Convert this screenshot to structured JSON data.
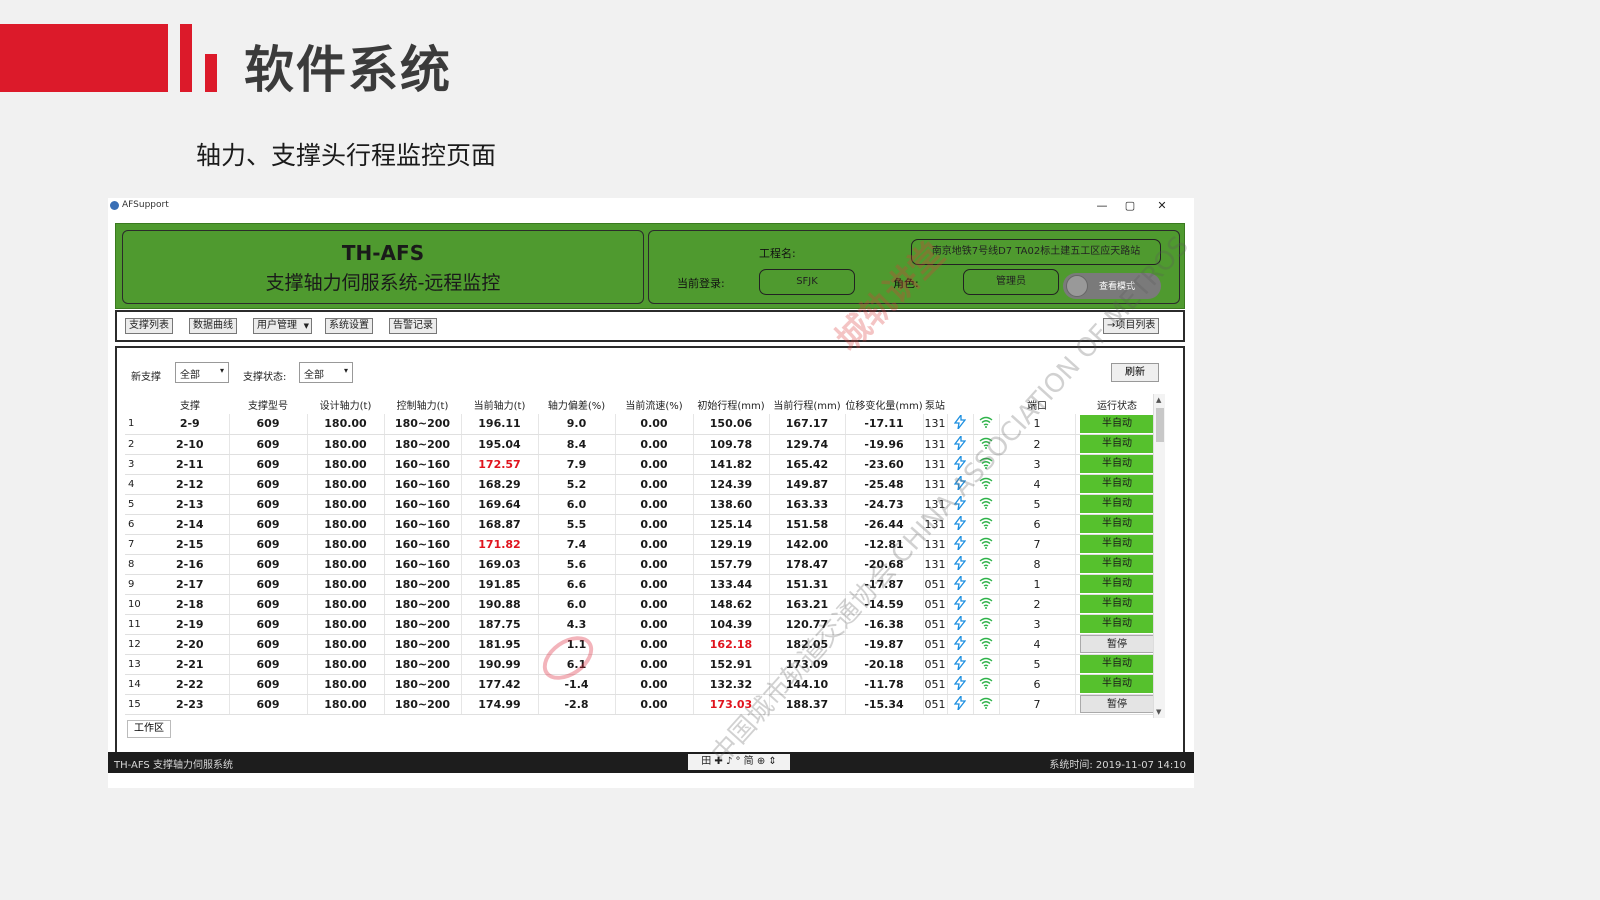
{
  "slide": {
    "title": "软件系统",
    "subtitle": "轴力、支撑头行程监控页面"
  },
  "window": {
    "app_name": "AFSupport",
    "min": "—",
    "max": "▢",
    "close": "✕"
  },
  "header": {
    "product": "TH-AFS",
    "system_name": "支撑轴力伺服系统-远程监控",
    "site_label": "工程名:",
    "site_value": "南京地铁7号线D7 TA02标土建五工区应天路站",
    "user_label": "当前登录:",
    "user_value": "SFJK",
    "role_label": "角色:",
    "role_value": "管理员",
    "toggle_label": "查看模式"
  },
  "toolbar": {
    "buttons": [
      "支撑列表",
      "数据曲线",
      "用户管理",
      "系统设置",
      "告警记录"
    ],
    "project_list": "→项目列表"
  },
  "filters": {
    "group_label": "新支撑",
    "group_value": "全部",
    "status_label": "支撑状态:",
    "status_value": "全部",
    "refresh": "刷新"
  },
  "table": {
    "headers": [
      "",
      "支撑",
      "支撑型号",
      "设计轴力(t)",
      "控制轴力(t)",
      "当前轴力(t)",
      "轴力偏差(%)",
      "当前流速(%)",
      "初始行程(mm)",
      "当前行程(mm)",
      "位移变化量(mm)",
      "泵站",
      "",
      "",
      "端口",
      "运行状态"
    ],
    "rows": [
      [
        "1",
        "2-9",
        "609",
        "180.00",
        "180~200",
        "196.11",
        "9.0",
        "0.00",
        "150.06",
        "167.17",
        "-17.11",
        "131",
        "1",
        "半自动"
      ],
      [
        "2",
        "2-10",
        "609",
        "180.00",
        "180~200",
        "195.04",
        "8.4",
        "0.00",
        "109.78",
        "129.74",
        "-19.96",
        "131",
        "2",
        "半自动"
      ],
      [
        "3",
        "2-11",
        "609",
        "180.00",
        "160~160",
        "172.57",
        "7.9",
        "0.00",
        "141.82",
        "165.42",
        "-23.60",
        "131",
        "3",
        "半自动"
      ],
      [
        "4",
        "2-12",
        "609",
        "180.00",
        "160~160",
        "168.29",
        "5.2",
        "0.00",
        "124.39",
        "149.87",
        "-25.48",
        "131",
        "4",
        "半自动"
      ],
      [
        "5",
        "2-13",
        "609",
        "180.00",
        "160~160",
        "169.64",
        "6.0",
        "0.00",
        "138.60",
        "163.33",
        "-24.73",
        "131",
        "5",
        "半自动"
      ],
      [
        "6",
        "2-14",
        "609",
        "180.00",
        "160~160",
        "168.87",
        "5.5",
        "0.00",
        "125.14",
        "151.58",
        "-26.44",
        "131",
        "6",
        "半自动"
      ],
      [
        "7",
        "2-15",
        "609",
        "180.00",
        "160~160",
        "171.82",
        "7.4",
        "0.00",
        "129.19",
        "142.00",
        "-12.81",
        "131",
        "7",
        "半自动"
      ],
      [
        "8",
        "2-16",
        "609",
        "180.00",
        "160~160",
        "169.03",
        "5.6",
        "0.00",
        "157.79",
        "178.47",
        "-20.68",
        "131",
        "8",
        "半自动"
      ],
      [
        "9",
        "2-17",
        "609",
        "180.00",
        "180~200",
        "191.85",
        "6.6",
        "0.00",
        "133.44",
        "151.31",
        "-17.87",
        "051",
        "1",
        "半自动"
      ],
      [
        "10",
        "2-18",
        "609",
        "180.00",
        "180~200",
        "190.88",
        "6.0",
        "0.00",
        "148.62",
        "163.21",
        "-14.59",
        "051",
        "2",
        "半自动"
      ],
      [
        "11",
        "2-19",
        "609",
        "180.00",
        "180~200",
        "187.75",
        "4.3",
        "0.00",
        "104.39",
        "120.77",
        "-16.38",
        "051",
        "3",
        "半自动"
      ],
      [
        "12",
        "2-20",
        "609",
        "180.00",
        "180~200",
        "181.95",
        "1.1",
        "0.00",
        "162.18",
        "182.05",
        "-19.87",
        "051",
        "4",
        "暂停"
      ],
      [
        "13",
        "2-21",
        "609",
        "180.00",
        "180~200",
        "190.99",
        "6.1",
        "0.00",
        "152.91",
        "173.09",
        "-20.18",
        "051",
        "5",
        "半自动"
      ],
      [
        "14",
        "2-22",
        "609",
        "180.00",
        "180~200",
        "177.42",
        "-1.4",
        "0.00",
        "132.32",
        "144.10",
        "-11.78",
        "051",
        "6",
        "半自动"
      ],
      [
        "15",
        "2-23",
        "609",
        "180.00",
        "180~200",
        "174.99",
        "-2.8",
        "0.00",
        "173.03",
        "188.37",
        "-15.34",
        "051",
        "7",
        "暂停"
      ]
    ],
    "red_cells": {
      "2": [
        5
      ],
      "6": [
        5
      ],
      "11": [
        8
      ],
      "14": [
        8
      ]
    },
    "colors": {
      "green": "#56c12d",
      "red": "#e0141e",
      "header_green": "#4f9a2f"
    }
  },
  "tab": "工作区",
  "statusbar": {
    "left": "TH-AFS 支撑轴力伺服系统",
    "mid": "田 ✚ ♪ ° 简 ⊕ ⇕",
    "right": "系统时间: 2019-11-07 14:10"
  },
  "watermark": {
    "w1": "城轨讲堂",
    "w2": "中国城市轨道交通协会 CHINA ASSOCIATION OF METROS"
  }
}
